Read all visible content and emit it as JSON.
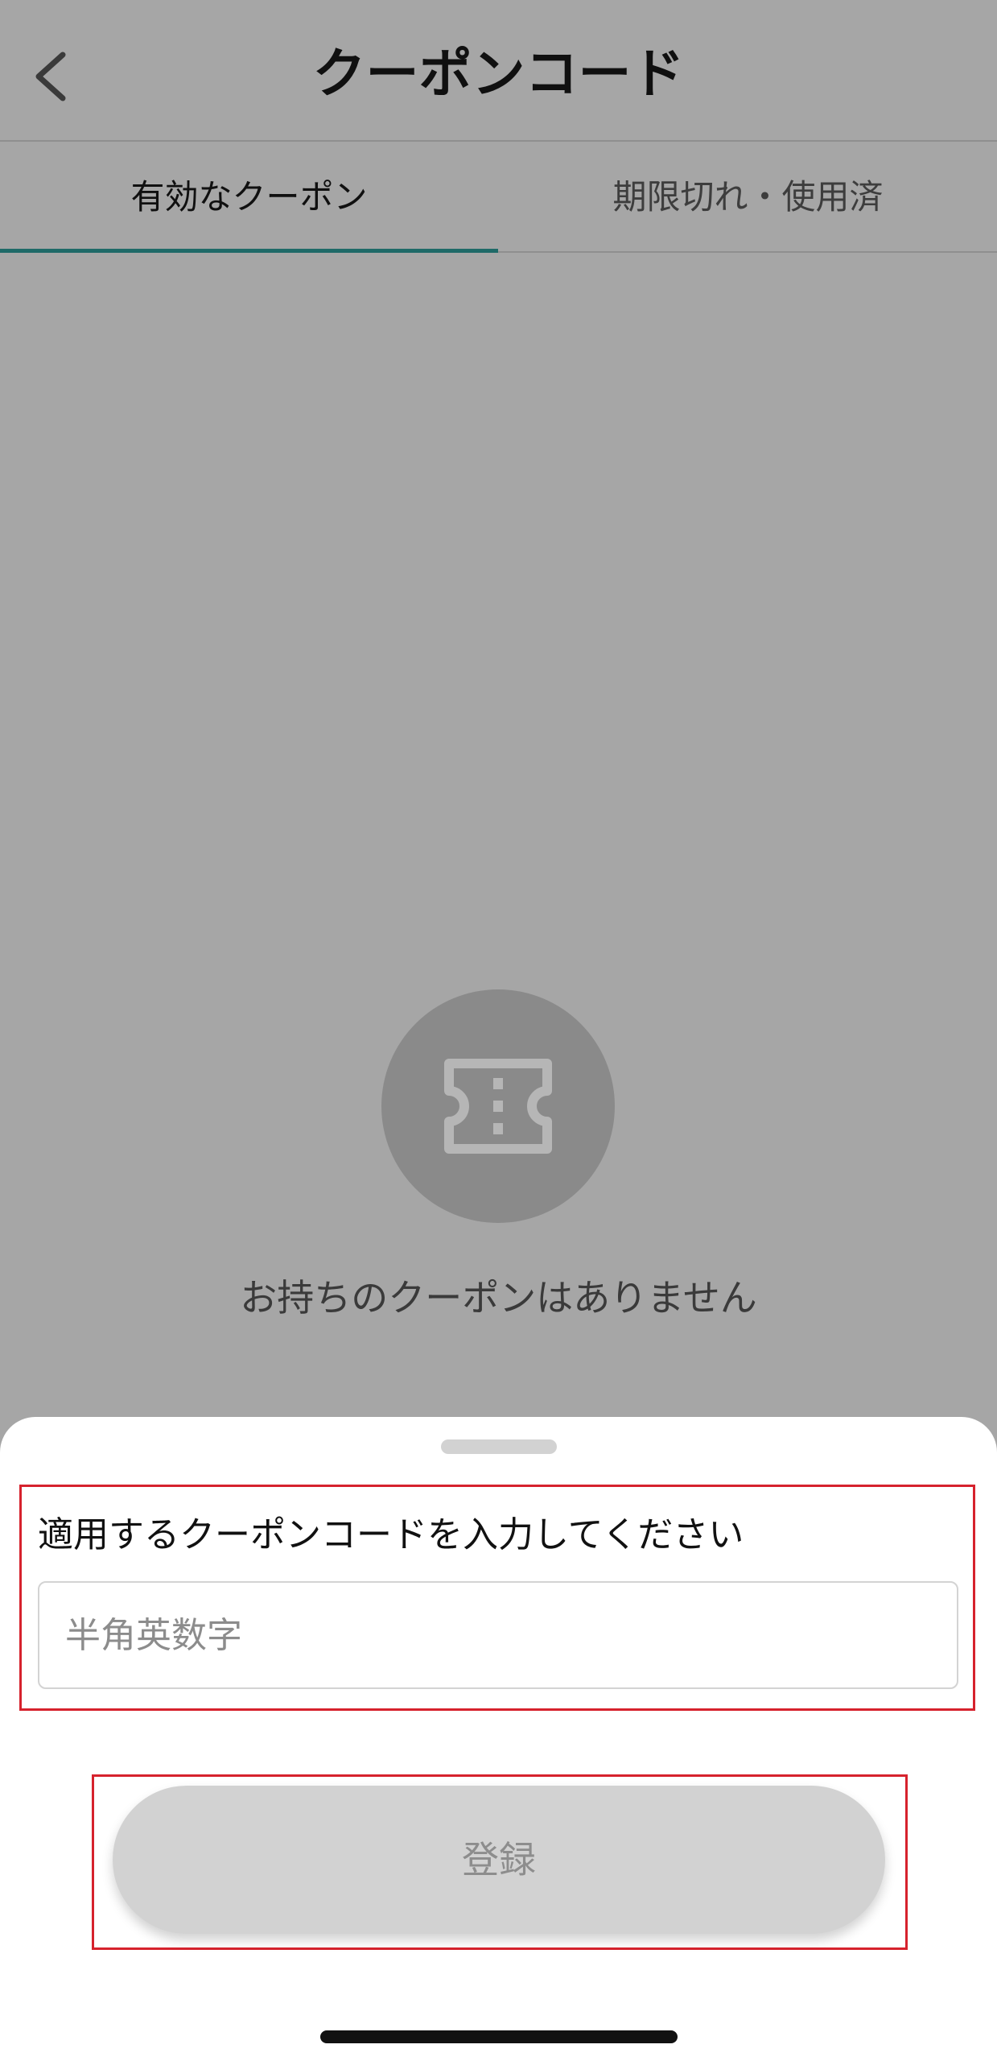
{
  "header": {
    "title": "クーポンコード",
    "back_icon": "chevron-left-icon"
  },
  "tabs": [
    {
      "label": "有効なクーポン",
      "active": true
    },
    {
      "label": "期限切れ・使用済",
      "active": false
    }
  ],
  "colors": {
    "tab_indicator": "#1f6a68",
    "overlay_background": "#a6a6a6",
    "highlight_border": "#d6222d"
  },
  "empty_state": {
    "icon": "ticket-icon",
    "message": "お持ちのクーポンはありません"
  },
  "sheet": {
    "label": "適用するクーポンコードを入力してください",
    "input": {
      "placeholder": "半角英数字",
      "value": ""
    },
    "submit_label": "登録"
  }
}
